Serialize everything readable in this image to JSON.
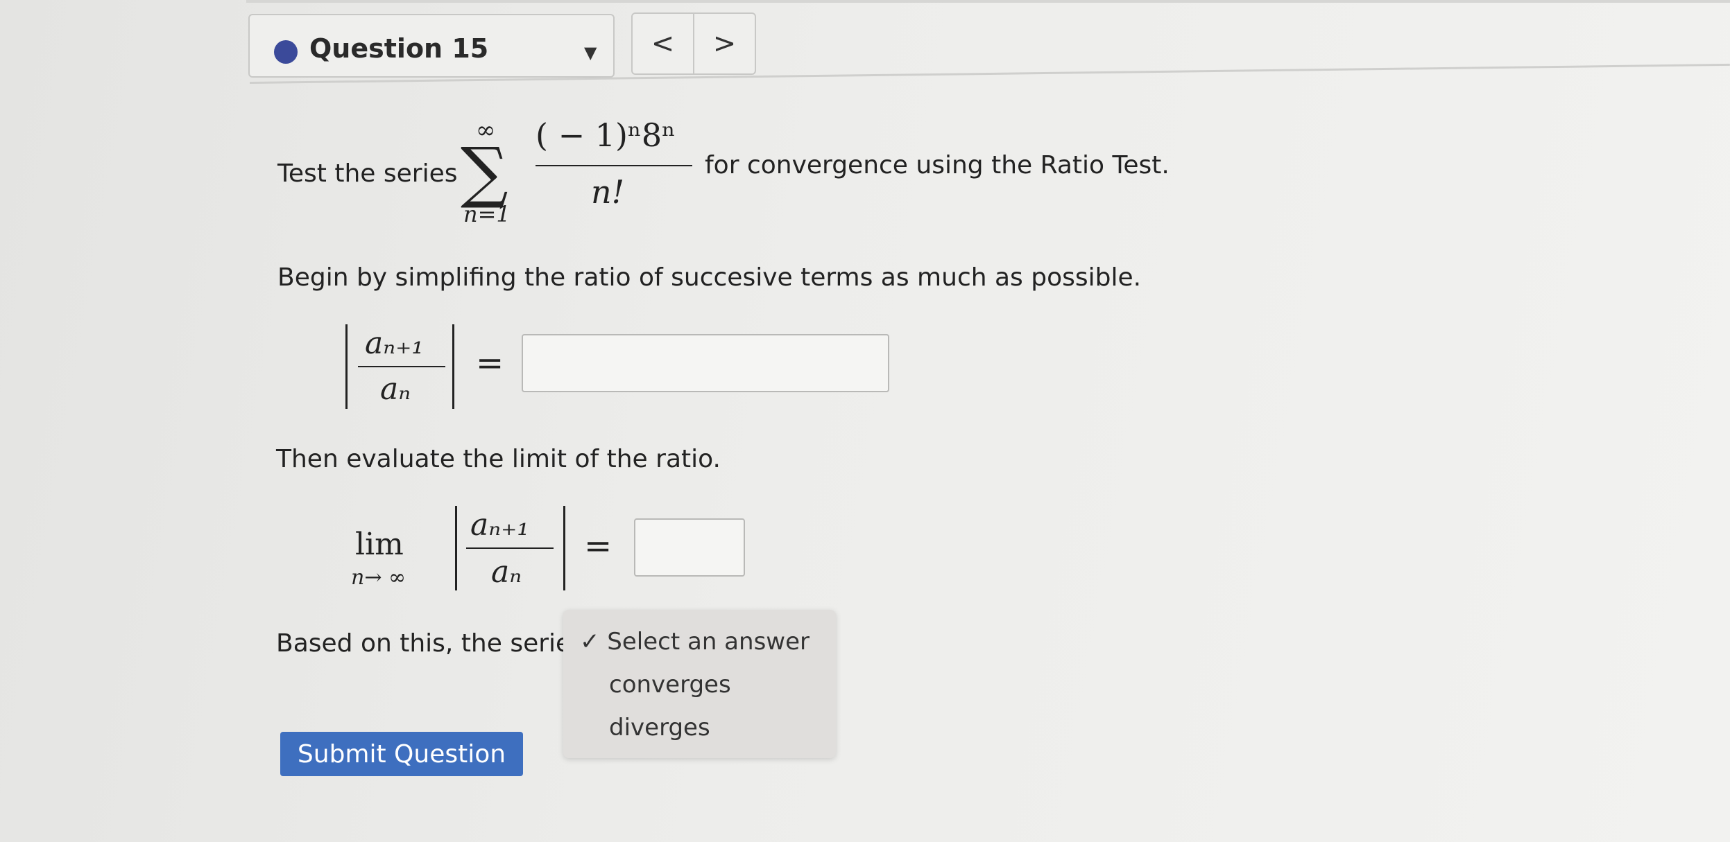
{
  "header": {
    "question_label": "Question 15",
    "prev_label": "<",
    "next_label": ">"
  },
  "problem": {
    "prompt_before": "Test the series",
    "prompt_after": "for convergence using the Ratio Test.",
    "sum_upper": "∞",
    "sum_lower": "n=1",
    "numerator": "( − 1)ⁿ8ⁿ",
    "denominator": "n!"
  },
  "step1": {
    "instruction": "Begin by simplifing the ratio of succesive terms as much as possible.",
    "ratio_num": "aₙ₊₁",
    "ratio_den": "aₙ",
    "equals": "=",
    "answer_value": ""
  },
  "step2": {
    "instruction": "Then evaluate the limit of the ratio.",
    "lim": "lim",
    "lim_sub": "n→ ∞",
    "ratio_num": "aₙ₊₁",
    "ratio_den": "aₙ",
    "equals": "=",
    "answer_value": ""
  },
  "conclusion": {
    "text": "Based on this, the serie:",
    "options": [
      "✓ Select an answer",
      "converges",
      "diverges"
    ]
  },
  "submit_label": "Submit Question",
  "colors": {
    "accent": "#3e6fbf",
    "status_dot": "#3b4a9a"
  }
}
